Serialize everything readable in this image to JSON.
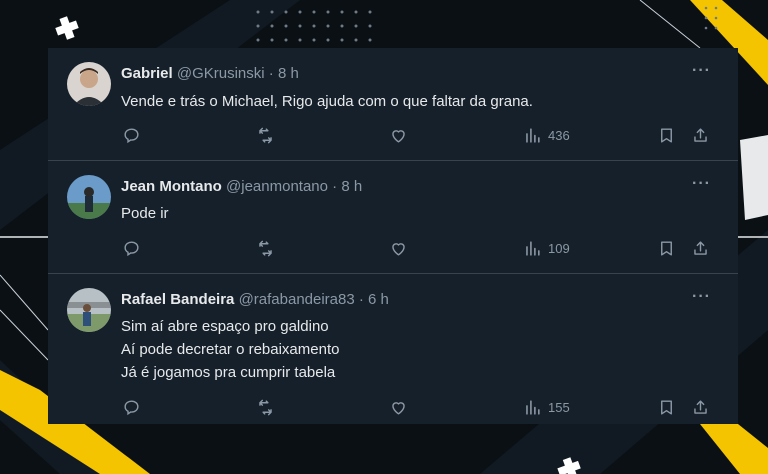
{
  "tweets": [
    {
      "display_name": "Gabriel",
      "handle": "@GKrusinski",
      "separator": "·",
      "time": "8 h",
      "lines": [
        "Vende e trás o Michael, Rigo ajuda com o que faltar da grana."
      ],
      "views": "436",
      "avatar_color": "#c9a58a"
    },
    {
      "display_name": "Jean Montano",
      "handle": "@jeanmontano",
      "separator": "·",
      "time": "8 h",
      "lines": [
        "Pode ir"
      ],
      "views": "109",
      "avatar_color": "#6a9bc9"
    },
    {
      "display_name": "Rafael Bandeira",
      "handle": "@rafabandeira83",
      "separator": "·",
      "time": "6 h",
      "lines": [
        "Sim aí abre espaço pro galdino",
        "Aí pode decretar o rebaixamento",
        "Já é jogamos pra cumprir tabela"
      ],
      "views": "155",
      "avatar_color": "#9aa88c"
    }
  ],
  "more_label": "···",
  "colors": {
    "card_bg": "#15202b",
    "text_primary": "#e7e9ea",
    "text_secondary": "#8b98a5",
    "divider": "#38444d",
    "accent_yellow": "#f5c400",
    "page_bg": "#0b1015"
  },
  "icons": [
    "reply-icon",
    "retweet-icon",
    "like-icon",
    "views-icon",
    "bookmark-icon",
    "share-icon",
    "more-icon"
  ]
}
